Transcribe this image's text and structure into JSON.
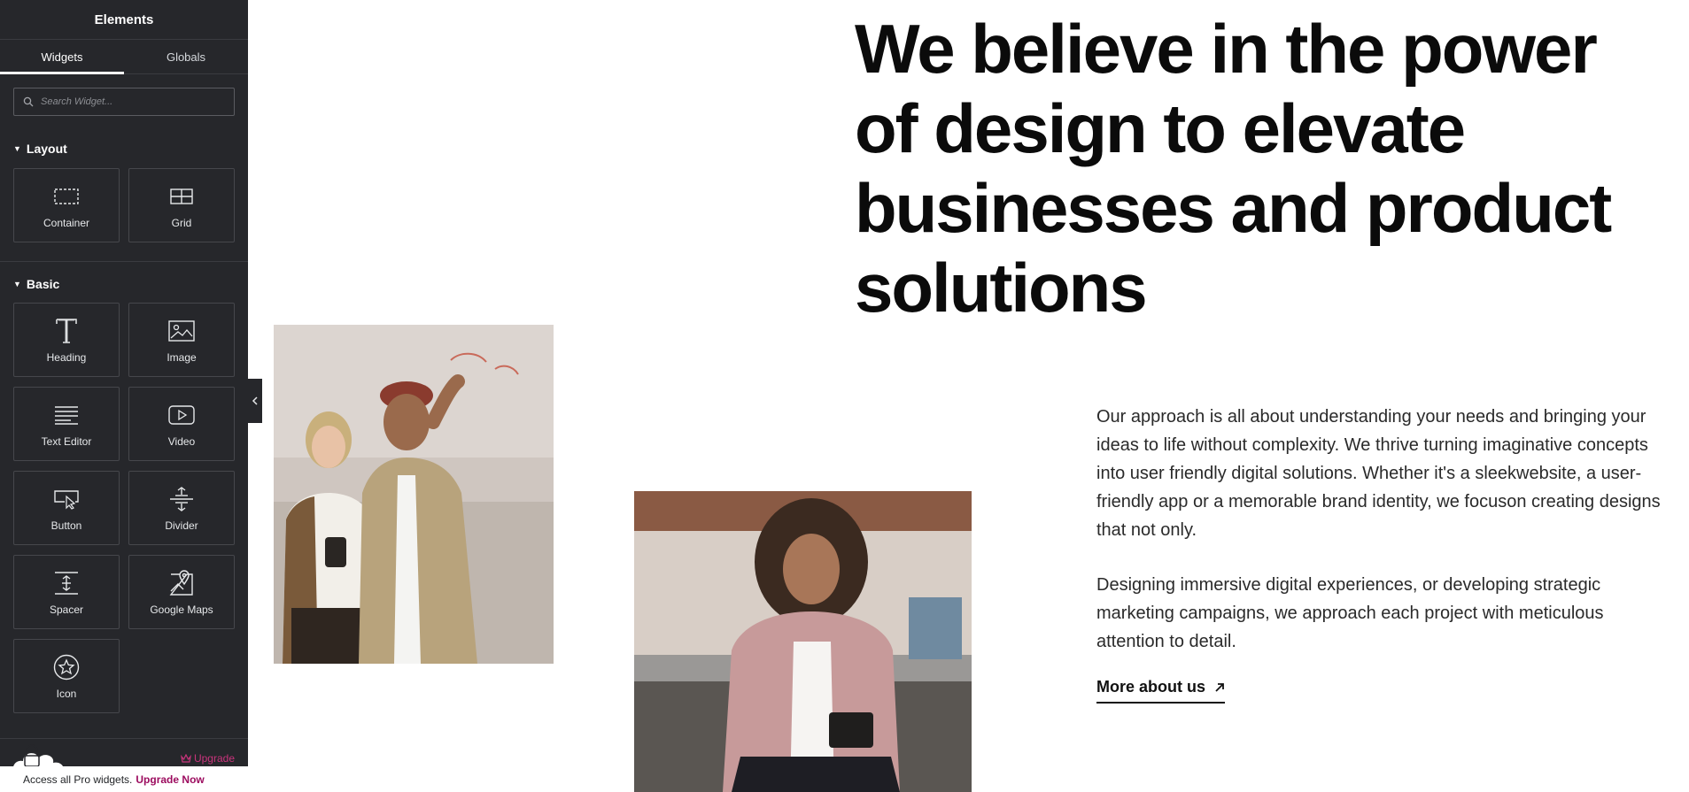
{
  "sidebar": {
    "title": "Elements",
    "tabs": [
      {
        "label": "Widgets",
        "active": true
      },
      {
        "label": "Globals",
        "active": false
      }
    ],
    "search": {
      "placeholder": "Search Widget..."
    },
    "sections": [
      {
        "title": "Layout",
        "widgets": [
          {
            "label": "Container",
            "icon": "container-icon"
          },
          {
            "label": "Grid",
            "icon": "grid-icon"
          }
        ]
      },
      {
        "title": "Basic",
        "widgets": [
          {
            "label": "Heading",
            "icon": "heading-icon"
          },
          {
            "label": "Image",
            "icon": "image-icon"
          },
          {
            "label": "Text Editor",
            "icon": "text-editor-icon"
          },
          {
            "label": "Video",
            "icon": "video-icon"
          },
          {
            "label": "Button",
            "icon": "button-icon"
          },
          {
            "label": "Divider",
            "icon": "divider-icon"
          },
          {
            "label": "Spacer",
            "icon": "spacer-icon"
          },
          {
            "label": "Google Maps",
            "icon": "map-icon"
          },
          {
            "label": "Icon",
            "icon": "star-icon"
          }
        ]
      }
    ],
    "upgrade_link": "Upgrade",
    "promo": {
      "text": "Access all Pro widgets.",
      "cta": "Upgrade Now"
    },
    "colors": {
      "background": "#26272b",
      "accent": "#c9347c"
    }
  },
  "page": {
    "headline": "We believe in the power of design to elevate businesses and product solutions",
    "paragraphs": [
      "Our approach is all about understanding your needs and bringing your ideas to life without complexity. We thrive turning imaginative concepts into user friendly digital solutions. Whether it's a sleekwebsite, a user-friendly app or a memorable brand identity, we focuson creating designs that not only.",
      "Designing immersive digital experiences, or developing strategic marketing campaigns, we approach each project with meticulous attention to detail."
    ],
    "more_link": "More about us"
  }
}
